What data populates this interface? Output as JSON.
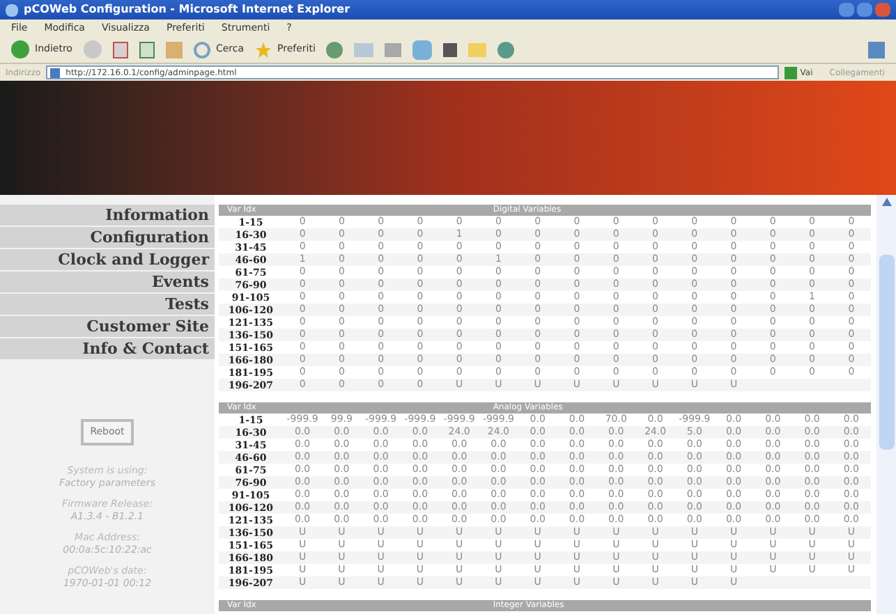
{
  "window": {
    "title": "pCOWeb Configuration - Microsoft Internet Explorer"
  },
  "menu": [
    "File",
    "Modifica",
    "Visualizza",
    "Preferiti",
    "Strumenti",
    "?"
  ],
  "toolbar": {
    "back": "Indietro",
    "search": "Cerca",
    "favorites": "Preferiti"
  },
  "address": {
    "label": "Indirizzo",
    "value": "http://172.16.0.1/config/adminpage.html",
    "go": "Vai",
    "links": "Collegamenti"
  },
  "sidebar": {
    "items": [
      "Information",
      "Configuration",
      "Clock and Logger",
      "Events",
      "Tests",
      "Customer Site",
      "Info & Contact"
    ],
    "reboot": "Reboot",
    "info": [
      [
        "System is using:",
        "Factory parameters"
      ],
      [
        "Firmware Release:",
        "A1.3.4 - B1.2.1"
      ],
      [
        "Mac Address:",
        "00:0a:5c:10:22:ac"
      ],
      [
        "pCOWeb's date:",
        "1970-01-01 00:12"
      ]
    ]
  },
  "tables": [
    {
      "index_header": "Var Idx",
      "title": "Digital Variables",
      "rows": [
        {
          "label": "1-15",
          "values": [
            "0",
            "0",
            "0",
            "0",
            "0",
            "0",
            "0",
            "0",
            "0",
            "0",
            "0",
            "0",
            "0",
            "0",
            "0"
          ]
        },
        {
          "label": "16-30",
          "values": [
            "0",
            "0",
            "0",
            "0",
            "1",
            "0",
            "0",
            "0",
            "0",
            "0",
            "0",
            "0",
            "0",
            "0",
            "0"
          ]
        },
        {
          "label": "31-45",
          "values": [
            "0",
            "0",
            "0",
            "0",
            "0",
            "0",
            "0",
            "0",
            "0",
            "0",
            "0",
            "0",
            "0",
            "0",
            "0"
          ]
        },
        {
          "label": "46-60",
          "values": [
            "1",
            "0",
            "0",
            "0",
            "0",
            "1",
            "0",
            "0",
            "0",
            "0",
            "0",
            "0",
            "0",
            "0",
            "0"
          ]
        },
        {
          "label": "61-75",
          "values": [
            "0",
            "0",
            "0",
            "0",
            "0",
            "0",
            "0",
            "0",
            "0",
            "0",
            "0",
            "0",
            "0",
            "0",
            "0"
          ]
        },
        {
          "label": "76-90",
          "values": [
            "0",
            "0",
            "0",
            "0",
            "0",
            "0",
            "0",
            "0",
            "0",
            "0",
            "0",
            "0",
            "0",
            "0",
            "0"
          ]
        },
        {
          "label": "91-105",
          "values": [
            "0",
            "0",
            "0",
            "0",
            "0",
            "0",
            "0",
            "0",
            "0",
            "0",
            "0",
            "0",
            "0",
            "1",
            "0"
          ]
        },
        {
          "label": "106-120",
          "values": [
            "0",
            "0",
            "0",
            "0",
            "0",
            "0",
            "0",
            "0",
            "0",
            "0",
            "0",
            "0",
            "0",
            "0",
            "0"
          ]
        },
        {
          "label": "121-135",
          "values": [
            "0",
            "0",
            "0",
            "0",
            "0",
            "0",
            "0",
            "0",
            "0",
            "0",
            "0",
            "0",
            "0",
            "0",
            "0"
          ]
        },
        {
          "label": "136-150",
          "values": [
            "0",
            "0",
            "0",
            "0",
            "0",
            "0",
            "0",
            "0",
            "0",
            "0",
            "0",
            "0",
            "0",
            "0",
            "0"
          ]
        },
        {
          "label": "151-165",
          "values": [
            "0",
            "0",
            "0",
            "0",
            "0",
            "0",
            "0",
            "0",
            "0",
            "0",
            "0",
            "0",
            "0",
            "0",
            "0"
          ]
        },
        {
          "label": "166-180",
          "values": [
            "0",
            "0",
            "0",
            "0",
            "0",
            "0",
            "0",
            "0",
            "0",
            "0",
            "0",
            "0",
            "0",
            "0",
            "0"
          ]
        },
        {
          "label": "181-195",
          "values": [
            "0",
            "0",
            "0",
            "0",
            "0",
            "0",
            "0",
            "0",
            "0",
            "0",
            "0",
            "0",
            "0",
            "0",
            "0"
          ]
        },
        {
          "label": "196-207",
          "values": [
            "0",
            "0",
            "0",
            "0",
            "U",
            "U",
            "U",
            "U",
            "U",
            "U",
            "U",
            "U"
          ]
        }
      ]
    },
    {
      "index_header": "Var Idx",
      "title": "Analog Variables",
      "rows": [
        {
          "label": "1-15",
          "values": [
            "-999.9",
            "99.9",
            "-999.9",
            "-999.9",
            "-999.9",
            "-999.9",
            "0.0",
            "0.0",
            "70.0",
            "0.0",
            "-999.9",
            "0.0",
            "0.0",
            "0.0",
            "0.0"
          ]
        },
        {
          "label": "16-30",
          "values": [
            "0.0",
            "0.0",
            "0.0",
            "0.0",
            "24.0",
            "24.0",
            "0.0",
            "0.0",
            "0.0",
            "24.0",
            "5.0",
            "0.0",
            "0.0",
            "0.0",
            "0.0"
          ]
        },
        {
          "label": "31-45",
          "values": [
            "0.0",
            "0.0",
            "0.0",
            "0.0",
            "0.0",
            "0.0",
            "0.0",
            "0.0",
            "0.0",
            "0.0",
            "0.0",
            "0.0",
            "0.0",
            "0.0",
            "0.0"
          ]
        },
        {
          "label": "46-60",
          "values": [
            "0.0",
            "0.0",
            "0.0",
            "0.0",
            "0.0",
            "0.0",
            "0.0",
            "0.0",
            "0.0",
            "0.0",
            "0.0",
            "0.0",
            "0.0",
            "0.0",
            "0.0"
          ]
        },
        {
          "label": "61-75",
          "values": [
            "0.0",
            "0.0",
            "0.0",
            "0.0",
            "0.0",
            "0.0",
            "0.0",
            "0.0",
            "0.0",
            "0.0",
            "0.0",
            "0.0",
            "0.0",
            "0.0",
            "0.0"
          ]
        },
        {
          "label": "76-90",
          "values": [
            "0.0",
            "0.0",
            "0.0",
            "0.0",
            "0.0",
            "0.0",
            "0.0",
            "0.0",
            "0.0",
            "0.0",
            "0.0",
            "0.0",
            "0.0",
            "0.0",
            "0.0"
          ]
        },
        {
          "label": "91-105",
          "values": [
            "0.0",
            "0.0",
            "0.0",
            "0.0",
            "0.0",
            "0.0",
            "0.0",
            "0.0",
            "0.0",
            "0.0",
            "0.0",
            "0.0",
            "0.0",
            "0.0",
            "0.0"
          ]
        },
        {
          "label": "106-120",
          "values": [
            "0.0",
            "0.0",
            "0.0",
            "0.0",
            "0.0",
            "0.0",
            "0.0",
            "0.0",
            "0.0",
            "0.0",
            "0.0",
            "0.0",
            "0.0",
            "0.0",
            "0.0"
          ]
        },
        {
          "label": "121-135",
          "values": [
            "0.0",
            "0.0",
            "0.0",
            "0.0",
            "0.0",
            "0.0",
            "0.0",
            "0.0",
            "0.0",
            "0.0",
            "0.0",
            "0.0",
            "0.0",
            "0.0",
            "0.0"
          ]
        },
        {
          "label": "136-150",
          "values": [
            "U",
            "U",
            "U",
            "U",
            "U",
            "U",
            "U",
            "U",
            "U",
            "U",
            "U",
            "U",
            "U",
            "U",
            "U"
          ]
        },
        {
          "label": "151-165",
          "values": [
            "U",
            "U",
            "U",
            "U",
            "U",
            "U",
            "U",
            "U",
            "U",
            "U",
            "U",
            "U",
            "U",
            "U",
            "U"
          ]
        },
        {
          "label": "166-180",
          "values": [
            "U",
            "U",
            "U",
            "U",
            "U",
            "U",
            "U",
            "U",
            "U",
            "U",
            "U",
            "U",
            "U",
            "U",
            "U"
          ]
        },
        {
          "label": "181-195",
          "values": [
            "U",
            "U",
            "U",
            "U",
            "U",
            "U",
            "U",
            "U",
            "U",
            "U",
            "U",
            "U",
            "U",
            "U",
            "U"
          ]
        },
        {
          "label": "196-207",
          "values": [
            "U",
            "U",
            "U",
            "U",
            "U",
            "U",
            "U",
            "U",
            "U",
            "U",
            "U",
            "U"
          ]
        }
      ]
    },
    {
      "index_header": "Var Idx",
      "title": "Integer Variables"
    }
  ]
}
